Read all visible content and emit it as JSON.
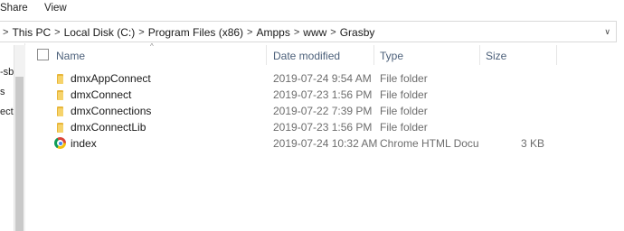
{
  "ribbon": {
    "tabs": [
      "Share",
      "View"
    ]
  },
  "address": {
    "breadcrumbs": [
      "This PC",
      "Local Disk (C:)",
      "Program Files (x86)",
      "Ampps",
      "www",
      "Grasby"
    ],
    "separator": ">",
    "dropdown_icon": "chevron-down-icon"
  },
  "navpane": {
    "fragments": [
      "-sb",
      "s",
      "ects"
    ]
  },
  "columns": {
    "name": "Name",
    "date": "Date modified",
    "type": "Type",
    "size": "Size",
    "sort_indicator": "^"
  },
  "files": [
    {
      "name": "dmxAppConnect",
      "date": "2019-07-24 9:54 AM",
      "type": "File folder",
      "size": "",
      "icon": "folder-icon"
    },
    {
      "name": "dmxConnect",
      "date": "2019-07-23 1:56 PM",
      "type": "File folder",
      "size": "",
      "icon": "folder-icon"
    },
    {
      "name": "dmxConnections",
      "date": "2019-07-22 7:39 PM",
      "type": "File folder",
      "size": "",
      "icon": "folder-icon"
    },
    {
      "name": "dmxConnectLib",
      "date": "2019-07-23 1:56 PM",
      "type": "File folder",
      "size": "",
      "icon": "folder-icon"
    },
    {
      "name": "index",
      "date": "2019-07-24 10:32 AM",
      "type": "Chrome HTML Docu...",
      "size": "3 KB",
      "icon": "chrome-icon"
    }
  ],
  "colors": {
    "header_text": "#4c607a",
    "folder": "#f6d36b",
    "meta_text": "#6d6d6d"
  }
}
